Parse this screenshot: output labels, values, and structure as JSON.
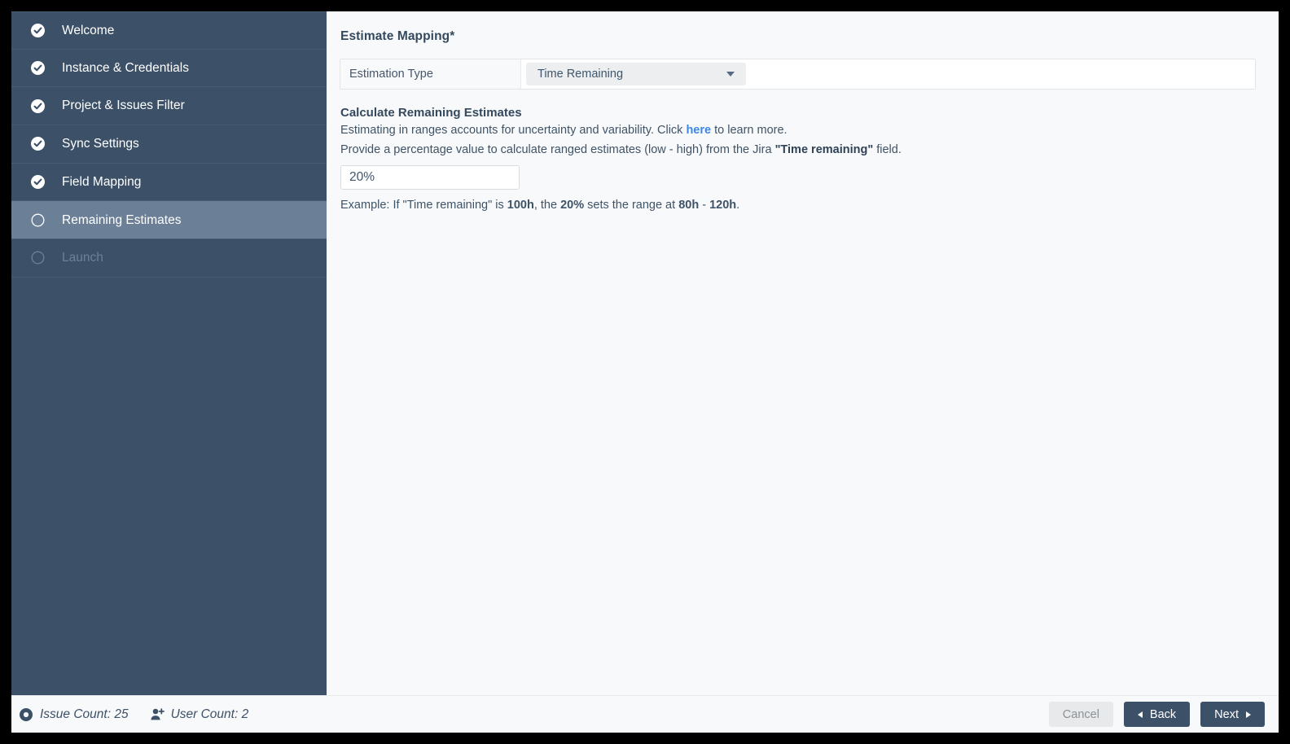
{
  "sidebar": {
    "items": [
      {
        "label": "Welcome",
        "state": "complete",
        "icon": "check-circle-icon"
      },
      {
        "label": "Instance & Credentials",
        "state": "complete",
        "icon": "check-circle-icon"
      },
      {
        "label": "Project & Issues Filter",
        "state": "complete",
        "icon": "check-circle-icon"
      },
      {
        "label": "Sync Settings",
        "state": "complete",
        "icon": "check-circle-icon"
      },
      {
        "label": "Field Mapping",
        "state": "complete",
        "icon": "check-circle-icon"
      },
      {
        "label": "Remaining Estimates",
        "state": "active",
        "icon": "empty-circle-icon"
      },
      {
        "label": "Launch",
        "state": "disabled",
        "icon": "empty-circle-icon"
      }
    ]
  },
  "main": {
    "page_title": "Estimate Mapping*",
    "estimation": {
      "label": "Estimation Type",
      "selected": "Time Remaining",
      "options": [
        "Time Remaining"
      ]
    },
    "calculate": {
      "heading": "Calculate Remaining Estimates",
      "line1_before_link": "Estimating in ranges accounts for uncertainty and variability. Click ",
      "link_text": "here",
      "line1_after_link": " to learn more.",
      "line2_part1": "Provide a percentage value to calculate ranged estimates (low - high) from the Jira ",
      "line2_bold": "\"Time remaining\"",
      "line2_part2": " field.",
      "percent_value": "20%",
      "percent_placeholder": "20%",
      "example_part1": "Example: If \"Time remaining\" is ",
      "example_bold1": "100h",
      "example_part2": ", the ",
      "example_bold2": "20%",
      "example_part3": " sets the range at ",
      "example_bold3": "80h",
      "example_part4": " - ",
      "example_bold4": "120h",
      "example_part5": "."
    }
  },
  "footer": {
    "issue_count": "Issue Count: 25",
    "user_count": "User Count: 2",
    "issue_icon": "record-circle-icon",
    "user_icon": "user-plus-icon",
    "cancel_label": "Cancel",
    "back_label": "Back",
    "next_label": "Next"
  },
  "colors": {
    "sidebar_bg": "#3c5068",
    "sidebar_active_bg": "#6b7f96",
    "accent_link": "#3b87e8",
    "text_primary": "#34495e",
    "page_bg": "#f8f9fa",
    "button_primary": "#3c5068"
  }
}
